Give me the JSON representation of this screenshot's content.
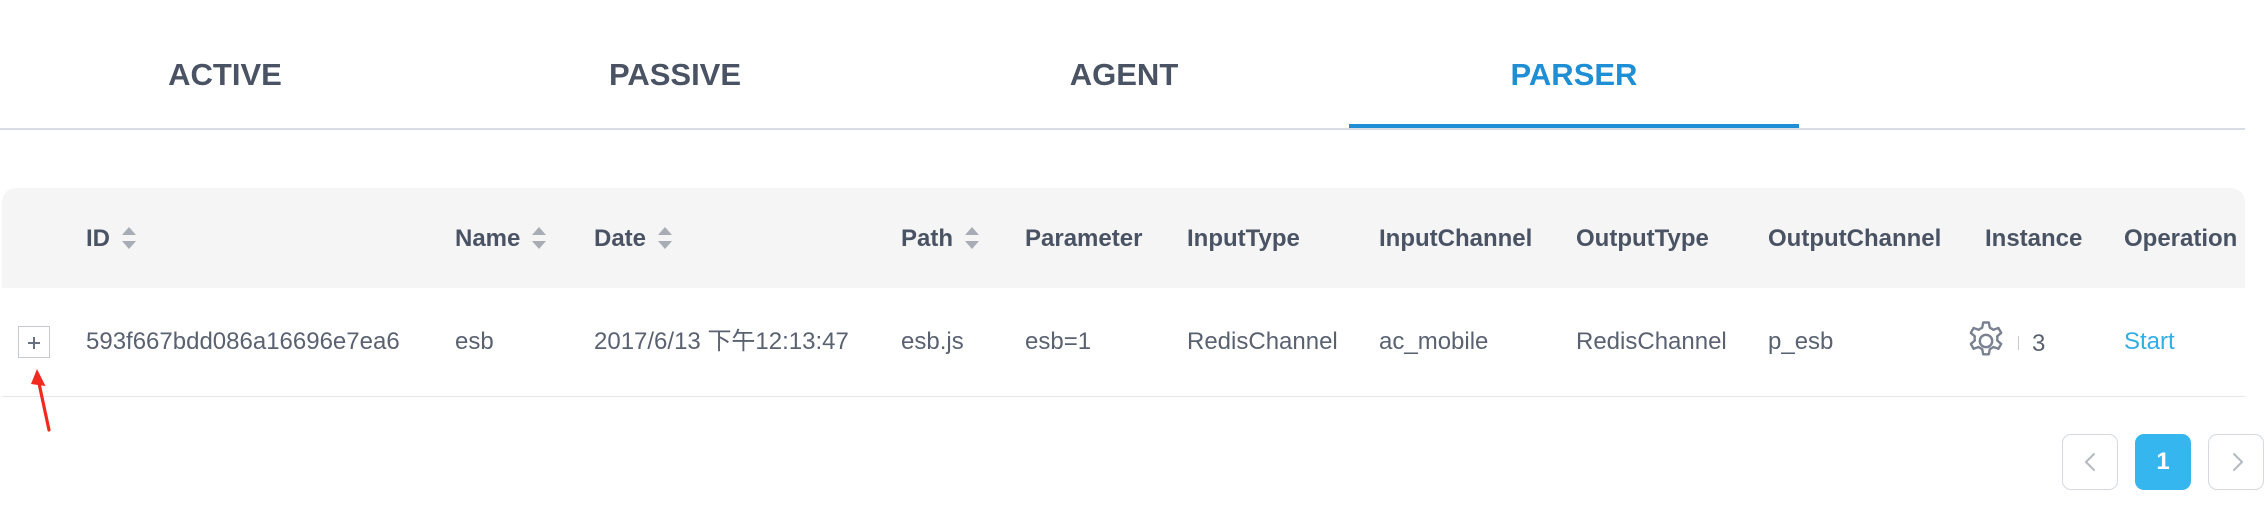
{
  "tabs": [
    {
      "label": "ACTIVE",
      "active": false
    },
    {
      "label": "PASSIVE",
      "active": false
    },
    {
      "label": "AGENT",
      "active": false
    },
    {
      "label": "PARSER",
      "active": true
    }
  ],
  "colors": {
    "accent": "#1e8fd5",
    "link": "#30aee6",
    "pager_active": "#36b6ee",
    "annotation_arrow": "#f02a1e"
  },
  "table": {
    "columns": [
      {
        "label": "ID",
        "sortable": true
      },
      {
        "label": "Name",
        "sortable": true
      },
      {
        "label": "Date",
        "sortable": true
      },
      {
        "label": "Path",
        "sortable": true
      },
      {
        "label": "Parameter",
        "sortable": false
      },
      {
        "label": "InputType",
        "sortable": false
      },
      {
        "label": "InputChannel",
        "sortable": false
      },
      {
        "label": "OutputType",
        "sortable": false
      },
      {
        "label": "OutputChannel",
        "sortable": false
      },
      {
        "label": "Instance",
        "sortable": false
      },
      {
        "label": "Operation",
        "sortable": false
      }
    ],
    "rows": [
      {
        "expand_icon": "plus-icon",
        "id": "593f667bdd086a16696e7ea6",
        "name": "esb",
        "date": "2017/6/13 下午12:13:47",
        "path": "esb.js",
        "parameter": "esb=1",
        "input_type": "RedisChannel",
        "input_channel": "ac_mobile",
        "output_type": "RedisChannel",
        "output_channel": "p_esb",
        "instance_icon": "gear-icon",
        "instance_count": "3",
        "operation": "Start"
      }
    ]
  },
  "pagination": {
    "prev_icon": "chevron-left-icon",
    "current_page": "1",
    "next_icon": "chevron-right-icon"
  }
}
